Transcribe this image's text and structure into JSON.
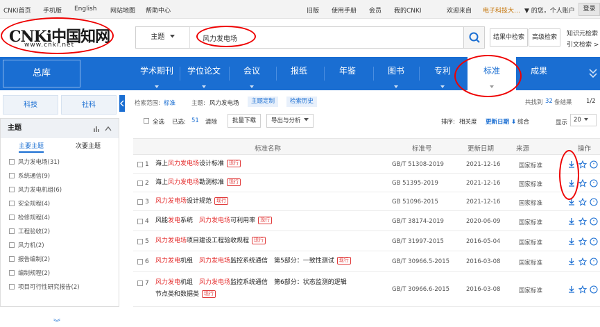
{
  "topbar": {
    "links": [
      "CNKI首页",
      "手机版",
      "English",
      "网站地图",
      "帮助中心"
    ],
    "right_links": [
      "旧版",
      "使用手册",
      "会员",
      "我的CNKI",
      "欢迎来自"
    ],
    "institution": "电子科技大…",
    "greeting": "▼ 的您，个人账户",
    "login": "登录"
  },
  "header": {
    "logo_text": "CNKi中国知网",
    "logo_url": "www.cnki.net",
    "field": "主题",
    "query": "风力发电场",
    "btn_in_results": "结果中检索",
    "btn_advanced": "高级检索",
    "link_knowledge": "知识元检索",
    "link_citation": "引文检索 >"
  },
  "nav": {
    "zongku": "总库",
    "items": [
      "学术期刊",
      "学位论文",
      "会议",
      "报纸",
      "年鉴",
      "图书",
      "专利",
      "标准",
      "成果"
    ],
    "active": "标准"
  },
  "sidebar": {
    "tabs": [
      "科技",
      "社科"
    ],
    "theme_title": "主题",
    "subtabs": [
      "主要主题",
      "次要主题"
    ],
    "items": [
      {
        "label": "风力发电场",
        "count": "(31)"
      },
      {
        "label": "系统通信",
        "count": "(9)"
      },
      {
        "label": "风力发电机组",
        "count": "(6)"
      },
      {
        "label": "安全规程",
        "count": "(4)"
      },
      {
        "label": "检修规程",
        "count": "(4)"
      },
      {
        "label": "工程验收",
        "count": "(2)"
      },
      {
        "label": "风力机",
        "count": "(2)"
      },
      {
        "label": "报告编制",
        "count": "(2)"
      },
      {
        "label": "编制规程",
        "count": "(2)"
      },
      {
        "label": "项目可行性研究报告",
        "count": "(2)"
      }
    ],
    "more": "︾"
  },
  "main": {
    "scope_label": "检索范围:",
    "scope_value": "标准",
    "theme_label": "主题:",
    "theme_value": "风力发电场",
    "theme_custom": "主题定制",
    "history": "检索历史",
    "found_prefix": "共找到",
    "found_count": "32",
    "found_suffix": "条结果",
    "page": "1/2",
    "select_all": "全选",
    "selected_label": "已选:",
    "selected_count": "51",
    "clear": "清除",
    "batch_download": "批量下载",
    "export": "导出与分析",
    "sort_label": "排序:",
    "sort_relevance": "相关度",
    "sort_date": "更新日期",
    "sort_composite": "综合",
    "display_label": "显示",
    "display_count": "20",
    "columns": [
      "标准名称",
      "标准号",
      "更新日期",
      "来源",
      "操作"
    ],
    "status_badge": "现行",
    "rows": [
      {
        "num": "1",
        "title": [
          [
            "海上",
            "n"
          ],
          [
            "风力发电场",
            "k"
          ],
          [
            "设计标准",
            "n"
          ]
        ],
        "title2": [],
        "std": "GB/T 51308-2019",
        "date": "2021-12-16",
        "source": "国家标准"
      },
      {
        "num": "2",
        "title": [
          [
            "海上",
            "n"
          ],
          [
            "风力发电场",
            "k"
          ],
          [
            "勘测标准",
            "n"
          ]
        ],
        "title2": [],
        "std": "GB 51395-2019",
        "date": "2021-12-16",
        "source": "国家标准"
      },
      {
        "num": "3",
        "title": [
          [
            "风力发电场",
            "k"
          ],
          [
            "设计规范",
            "n"
          ]
        ],
        "title2": [],
        "std": "GB 51096-2015",
        "date": "2021-12-16",
        "source": "国家标准"
      },
      {
        "num": "4",
        "title": [
          [
            "风能",
            "n"
          ],
          [
            "发电",
            "k"
          ],
          [
            "系统　",
            "n"
          ],
          [
            "风力发电场",
            "k"
          ],
          [
            "可利用率",
            "n"
          ]
        ],
        "title2": [],
        "std": "GB/T 38174-2019",
        "date": "2020-06-09",
        "source": "国家标准"
      },
      {
        "num": "5",
        "title": [
          [
            "风力发电场",
            "k"
          ],
          [
            "项目建设工程验收规程",
            "n"
          ]
        ],
        "title2": [],
        "std": "GB/T 31997-2015",
        "date": "2016-05-04",
        "source": "国家标准"
      },
      {
        "num": "6",
        "title": [
          [
            "风力发电",
            "k"
          ],
          [
            "机组　",
            "n"
          ],
          [
            "风力发电场",
            "k"
          ],
          [
            "监控系统通信　第5部分：一致性测试",
            "n"
          ]
        ],
        "title2": [],
        "std": "GB/T 30966.5-2015",
        "date": "2016-03-08",
        "source": "国家标准"
      },
      {
        "num": "7",
        "title": [
          [
            "风力发电",
            "k"
          ],
          [
            "机组　",
            "n"
          ],
          [
            "风力发电场",
            "k"
          ],
          [
            "监控系统通信　第6部分：状态监测的逻辑",
            "n"
          ]
        ],
        "title2": [
          [
            "节点类和数据类",
            "n"
          ]
        ],
        "std": "GB/T 30966.6-2015",
        "date": "2016-03-08",
        "source": "国家标准"
      }
    ]
  },
  "colors": {
    "primary": "#1a6ed2",
    "keyword": "#e42a2a",
    "annotation": "#e00000",
    "accent": "#c47000"
  }
}
